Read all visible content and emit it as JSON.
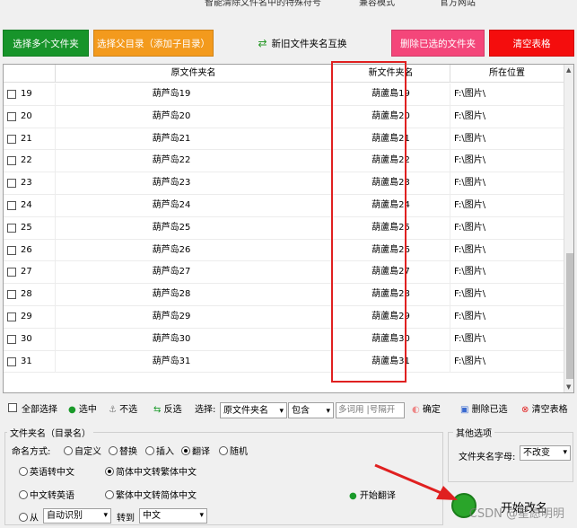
{
  "top": {
    "items": [
      "智能清除文件名中的特殊符号",
      "兼容模式",
      "官方网站"
    ]
  },
  "buttons": {
    "select_multi": "选择多个文件夹",
    "select_parent": "选择父目录（添加子目录）",
    "swap": "新旧文件夹名互换",
    "delete_selected": "删除已选的文件夹",
    "clear_table": "清空表格"
  },
  "table": {
    "headers": [
      "原文件夹名",
      "新文件夹名",
      "所在位置"
    ],
    "rows": [
      {
        "num": "19",
        "old": "葫芦岛19",
        "new": "葫蘆島19",
        "loc": "F:\\图片\\"
      },
      {
        "num": "20",
        "old": "葫芦岛20",
        "new": "葫蘆島20",
        "loc": "F:\\图片\\"
      },
      {
        "num": "21",
        "old": "葫芦岛21",
        "new": "葫蘆島21",
        "loc": "F:\\图片\\"
      },
      {
        "num": "22",
        "old": "葫芦岛22",
        "new": "葫蘆島22",
        "loc": "F:\\图片\\"
      },
      {
        "num": "23",
        "old": "葫芦岛23",
        "new": "葫蘆島23",
        "loc": "F:\\图片\\"
      },
      {
        "num": "24",
        "old": "葫芦岛24",
        "new": "葫蘆島24",
        "loc": "F:\\图片\\"
      },
      {
        "num": "25",
        "old": "葫芦岛25",
        "new": "葫蘆島25",
        "loc": "F:\\图片\\"
      },
      {
        "num": "26",
        "old": "葫芦岛26",
        "new": "葫蘆島26",
        "loc": "F:\\图片\\"
      },
      {
        "num": "27",
        "old": "葫芦岛27",
        "new": "葫蘆島27",
        "loc": "F:\\图片\\"
      },
      {
        "num": "28",
        "old": "葫芦岛28",
        "new": "葫蘆島28",
        "loc": "F:\\图片\\"
      },
      {
        "num": "29",
        "old": "葫芦岛29",
        "new": "葫蘆島29",
        "loc": "F:\\图片\\"
      },
      {
        "num": "30",
        "old": "葫芦岛30",
        "new": "葫蘆島30",
        "loc": "F:\\图片\\"
      },
      {
        "num": "31",
        "old": "葫芦岛31",
        "new": "葫蘆島31",
        "loc": "F:\\图片\\"
      }
    ]
  },
  "toolbar": {
    "select_all": "全部选择",
    "check": "选中",
    "uncheck": "不选",
    "invert": "反选",
    "choose_label": "选择:",
    "field_value": "原文件夹名",
    "match_value": "包含",
    "keyword_placeholder": "多词用 |号隔开",
    "confirm": "确定",
    "delete_checked": "删除已选",
    "clear_table": "清空表格"
  },
  "naming": {
    "group_title": "文件夹名（目录名）",
    "mode_label": "命名方式:",
    "modes": [
      "自定义",
      "替换",
      "插入",
      "翻译",
      "随机"
    ],
    "selected_mode": "翻译",
    "options": [
      "英语转中文",
      "简体中文转繁体中文",
      "中文转英语",
      "繁体中文转简体中文"
    ],
    "selected_option": "简体中文转繁体中文",
    "start_translate": "开始翻译",
    "from_label": "从",
    "from_value": "自动识别",
    "to_label": "转到",
    "to_value": "中文"
  },
  "other": {
    "group_title": "其他选项",
    "char_label": "文件夹名字母:",
    "char_value": "不改变"
  },
  "start": {
    "label": "开始改名"
  },
  "watermark": "CSDN @星愿明明"
}
